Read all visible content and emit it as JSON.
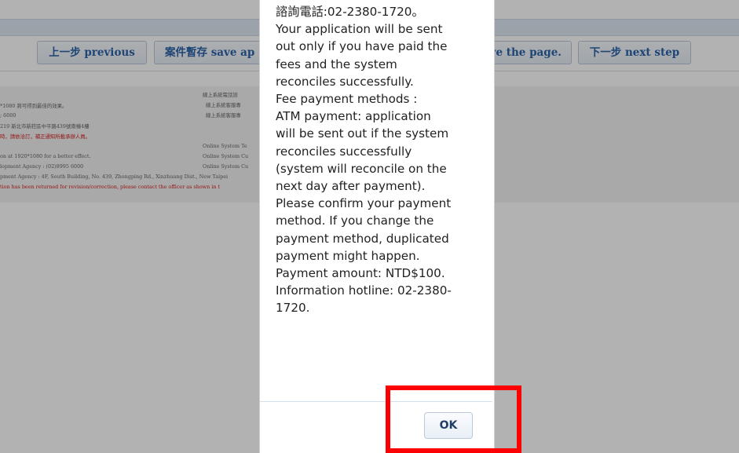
{
  "nav": {
    "previous_label": "上一步 previous",
    "save_label": "案件暫存 save ap",
    "save_page_label": "ve the page.",
    "next_label": "下一步 next step"
  },
  "footer": {
    "l1": "*1080  將可得到最佳的效果。",
    "l2": "; 6000",
    "l3": "219  新北市新莊區中平路439號南棟4樓",
    "l4": "時，請依洽訂，補正通知所載承辦人員。",
    "l5": "on at 1920*1080 for a better effect.",
    "l6": "lopment Agency : (02)8995 6000",
    "l7": "pment Agency : 4F, South Building, No. 439, Zhongping Rd., Xinzhuang Dist., New Taipei",
    "l8": "tion has been returned for revision/correction, please contact the officer as shown in t",
    "r1": "線上系統電話諮",
    "r2": "線上系統客服專",
    "r3": "線上系統客服專",
    "r4": "Online System Te",
    "r5": "Online System Cu",
    "r6": "Online System Cu"
  },
  "dialog": {
    "lines": [
      "諮詢電話:02-2380-1720。",
      "Your application will be sent",
      "out only if you have paid the",
      "fees and the system",
      "reconciles successfully.",
      "Fee payment methods :",
      "ATM payment: application",
      "will be sent out if the system",
      "reconciles successfully",
      "(system will reconcile on the",
      "next day after payment).",
      "Please confirm your payment",
      "method. If you change the",
      "payment method, duplicated",
      "payment might happen.",
      "Payment amount: NTD$100.",
      "Information hotline: 02-2380-",
      "1720."
    ],
    "ok_label": "OK"
  },
  "colors": {
    "highlight": "#ff0000",
    "button_text": "#2b63a8",
    "footer_alert": "#d62020"
  }
}
